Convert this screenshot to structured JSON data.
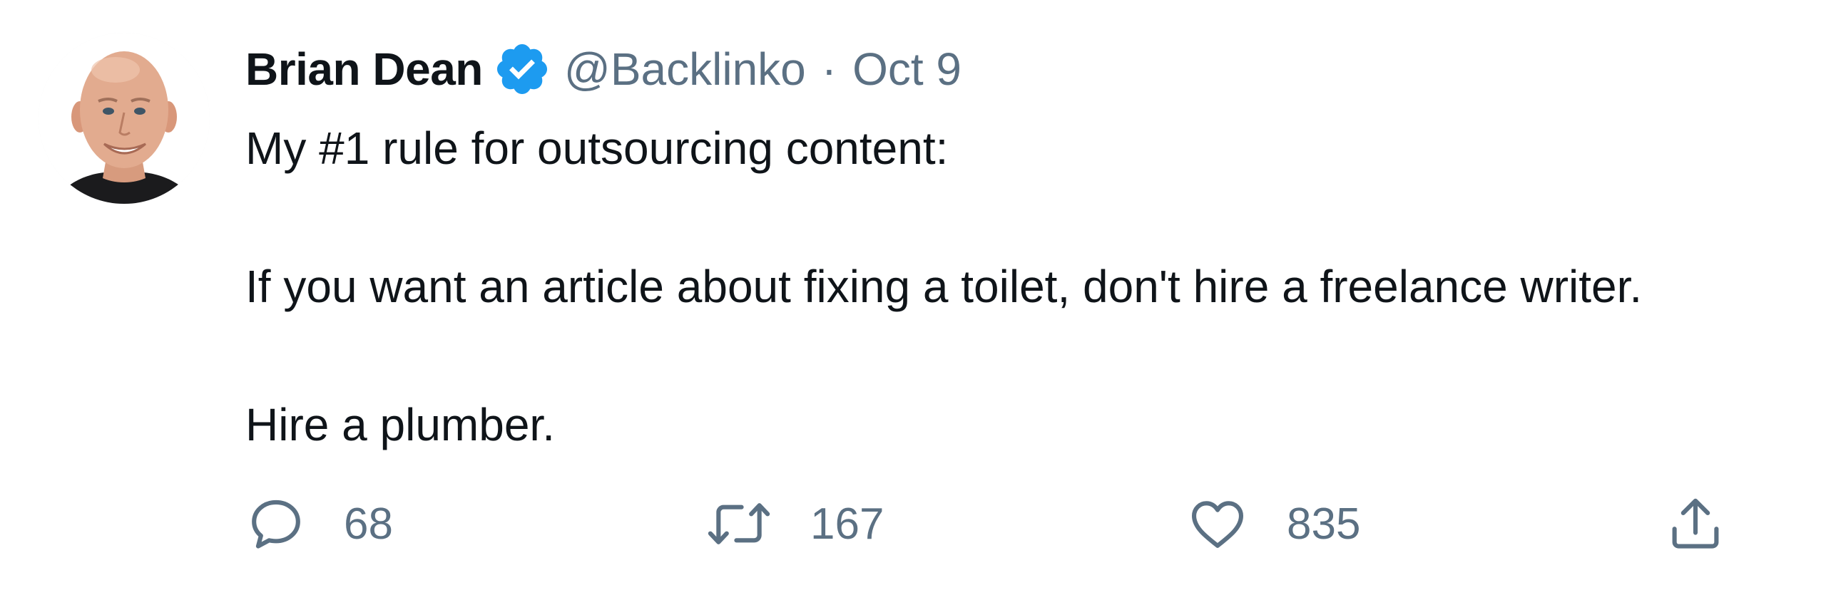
{
  "tweet": {
    "author": {
      "name": "Brian Dean",
      "handle": "@Backlinko",
      "verified": true,
      "avatar_icon": "user-avatar-photo"
    },
    "separator": "·",
    "date": "Oct 9",
    "text": {
      "line1": "My #1 rule for outsourcing content:",
      "line2": "If you want an article about fixing a toilet, don't hire a freelance writer.",
      "line3": "Hire a plumber."
    },
    "actions": {
      "reply": {
        "icon": "reply-icon",
        "count": "68"
      },
      "retweet": {
        "icon": "retweet-icon",
        "count": "167"
      },
      "like": {
        "icon": "heart-icon",
        "count": "835"
      },
      "share": {
        "icon": "share-icon"
      }
    }
  },
  "colors": {
    "text_primary": "#0f1419",
    "text_secondary": "#5b7083",
    "verified_blue": "#1d9bf0"
  }
}
